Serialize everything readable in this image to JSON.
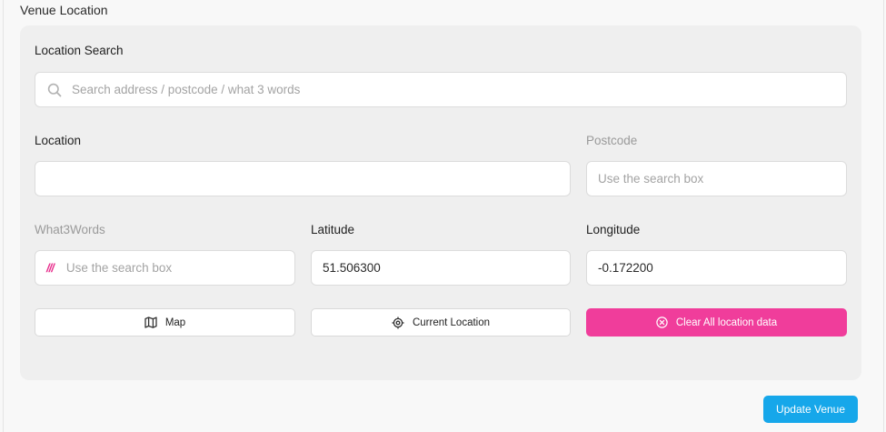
{
  "section": {
    "title": "Venue Location"
  },
  "search": {
    "label": "Location Search",
    "placeholder": "Search address / postcode / what 3 words"
  },
  "location": {
    "label": "Location",
    "value": ""
  },
  "postcode": {
    "label": "Postcode",
    "placeholder": "Use the search box"
  },
  "what3words": {
    "label": "What3Words",
    "placeholder": "Use the search box",
    "icon": "///"
  },
  "latitude": {
    "label": "Latitude",
    "value": "51.506300"
  },
  "longitude": {
    "label": "Longitude",
    "value": "-0.172200"
  },
  "buttons": {
    "map": "Map",
    "current_location": "Current Location",
    "clear": "Clear All location data",
    "update": "Update Venue"
  },
  "colors": {
    "accent_pink": "#f03d9b",
    "accent_blue": "#16a7ea",
    "panel_bg": "#efefef"
  }
}
